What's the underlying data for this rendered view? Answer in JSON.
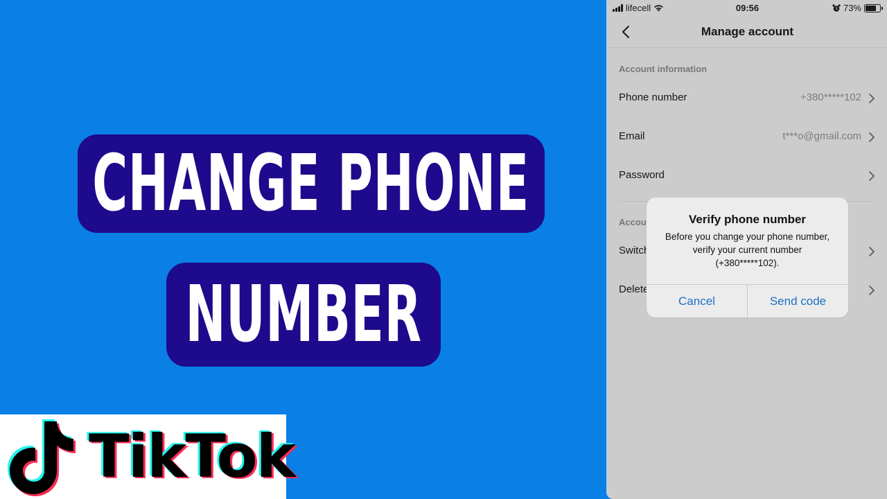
{
  "thumbnail": {
    "title_line_1": "CHANGE PHONE",
    "title_line_2": "NUMBER",
    "background_color": "#0a7fe6",
    "title_box_color": "#1e0a8c",
    "title_text_color": "#ffffff"
  },
  "logo": {
    "wordmark": "TikTok",
    "icon": "tiktok-note-icon",
    "accent_cyan": "#25f4ee",
    "accent_red": "#fe2c55"
  },
  "phone": {
    "status_bar": {
      "carrier": "lifecell",
      "time": "09:56",
      "battery": "73%",
      "battery_level": 0.73,
      "icons": [
        "signal-icon",
        "wifi-icon",
        "alarm-icon",
        "battery-icon"
      ]
    },
    "nav": {
      "title": "Manage account",
      "back_icon": "chevron-left-icon"
    },
    "sections": [
      {
        "header": "Account information",
        "rows": [
          {
            "label": "Phone number",
            "value": "+380*****102"
          },
          {
            "label": "Email",
            "value": "t***o@gmail.com"
          },
          {
            "label": "Password",
            "value": ""
          }
        ]
      },
      {
        "header": "Accou",
        "rows": [
          {
            "label": "Switch",
            "value": ""
          },
          {
            "label": "Delete",
            "value": ""
          }
        ]
      }
    ],
    "alert": {
      "title": "Verify phone number",
      "message": "Before you change your phone number, verify your current number (+380*****102).",
      "cancel_label": "Cancel",
      "confirm_label": "Send code",
      "button_color": "#1f6fc5"
    }
  }
}
